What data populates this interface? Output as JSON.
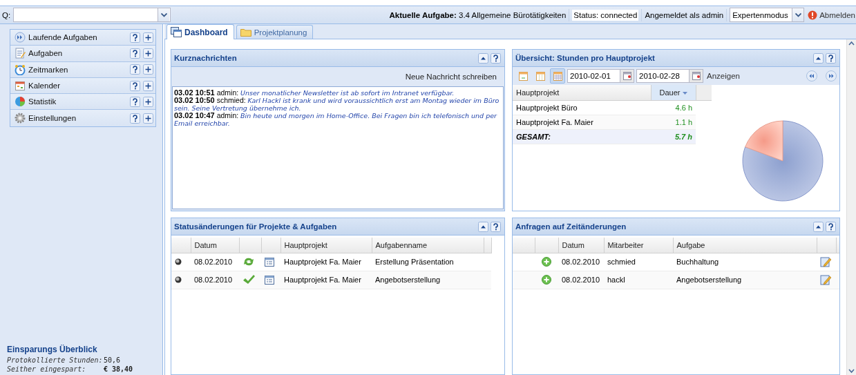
{
  "top_bar": {
    "search_label": "Q:",
    "current_task_label": "Aktuelle Aufgabe:",
    "current_task": "3.4 Allgemeine Bürotätigkeiten",
    "status": "Status: connected",
    "logged_in": "Angemeldet als admin",
    "mode": "Expertenmodus",
    "logout": "Abmelden"
  },
  "sidebar": {
    "items": [
      {
        "kind": "running",
        "label": "Laufende Aufgaben"
      },
      {
        "kind": "tasks",
        "label": "Aufgaben"
      },
      {
        "kind": "clock",
        "label": "Zeitmarken"
      },
      {
        "kind": "calendar",
        "label": "Kalender"
      },
      {
        "kind": "stats",
        "label": "Statistik"
      },
      {
        "kind": "settings",
        "label": "Einstellungen"
      }
    ],
    "summary": {
      "title": "Einsparungs Überblick",
      "rows": [
        {
          "label": "Protokollierte Stunden:",
          "value": "50,6",
          "bold": false
        },
        {
          "label": "Seither eingespart:",
          "value": "€ 38,40",
          "bold": true
        }
      ]
    }
  },
  "tabs": [
    {
      "kind": "dashboard",
      "label": "Dashboard",
      "selected": true
    },
    {
      "kind": "folder",
      "label": "Projektplanung",
      "selected": false
    }
  ],
  "news": {
    "title": "Kurznachrichten",
    "action": "Neue Nachricht schreiben",
    "messages": [
      {
        "time": "03.02 10:51",
        "author": "admin:",
        "text": "Unser monatlicher Newsletter ist ab sofort im Intranet verfügbar."
      },
      {
        "time": "03.02 10:50",
        "author": "schmied:",
        "text": "Karl Hackl ist krank und wird voraussichtlich erst am Montag wieder im Büro sein. Seine Vertretung übernehme ich."
      },
      {
        "time": "03.02 10:47",
        "author": "admin:",
        "text": "Bin heute und morgen im Home-Office. Bei Fragen bin ich telefonisch und per Email erreichbar."
      }
    ]
  },
  "hours": {
    "title": "Übersicht: Stunden pro Hauptprojekt",
    "views": [
      {
        "kind": "day",
        "selected": false
      },
      {
        "kind": "week",
        "selected": false
      },
      {
        "kind": "month",
        "selected": true
      }
    ],
    "from": "2010-02-01",
    "to": "2010-02-28",
    "show_button": "Anzeigen",
    "columns": [
      "Hauptprojekt",
      "Dauer"
    ],
    "rows": [
      {
        "project": "Hauptprojekt Büro",
        "duration": "4.6 h"
      },
      {
        "project": "Hauptprojekt Fa. Maier",
        "duration": "1.1 h"
      }
    ],
    "total": {
      "label": "GESAMT:",
      "value": "5.7 h"
    }
  },
  "status_changes": {
    "title": "Statusänderungen für Projekte & Aufgaben",
    "columns": [
      "Datum",
      "Hauptprojekt",
      "Aufgabenname"
    ],
    "rows": [
      {
        "date": "08.02.2010",
        "kind": "changed",
        "project": "Hauptprojekt Fa. Maier",
        "task": "Erstellung Präsentation"
      },
      {
        "date": "08.02.2010",
        "kind": "done",
        "project": "Hauptprojekt Fa. Maier",
        "task": "Angebotserstellung"
      }
    ]
  },
  "requests": {
    "title": "Anfragen auf Zeitänderungen",
    "columns": [
      "Datum",
      "Mitarbeiter",
      "Aufgabe"
    ],
    "rows": [
      {
        "date": "08.02.2010",
        "employee": "schmied",
        "task": "Buchhaltung"
      },
      {
        "date": "08.02.2010",
        "employee": "hackl",
        "task": "Angebotserstellung"
      }
    ]
  }
}
